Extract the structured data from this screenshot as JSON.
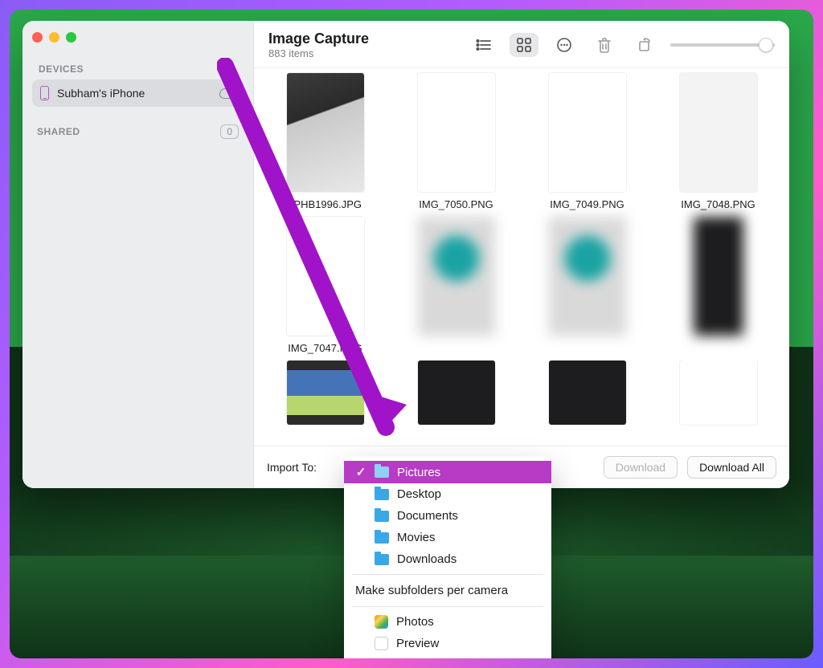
{
  "app": {
    "title": "Image Capture",
    "item_count_label": "883 items"
  },
  "sidebar": {
    "devices_label": "DEVICES",
    "shared_label": "SHARED",
    "shared_count": "0",
    "device_name": "Subham's iPhone"
  },
  "toolbar": {
    "list_icon": "list-icon",
    "grid_icon": "grid-icon",
    "more_icon": "more-icon",
    "trash_icon": "trash-icon",
    "rotate_icon": "rotate-icon"
  },
  "grid": {
    "files": [
      "JPHB1996.JPG",
      "IMG_7050.PNG",
      "IMG_7049.PNG",
      "IMG_7048.PNG",
      "IMG_7047.PNG",
      "",
      "",
      "",
      "",
      "",
      "",
      ""
    ]
  },
  "footer": {
    "import_label": "Import To:",
    "download_label": "Download",
    "download_all_label": "Download All"
  },
  "menu": {
    "items": [
      "Pictures",
      "Desktop",
      "Documents",
      "Movies",
      "Downloads"
    ],
    "subfolders_label": "Make subfolders per camera",
    "apps": [
      "Photos",
      "Preview"
    ]
  }
}
